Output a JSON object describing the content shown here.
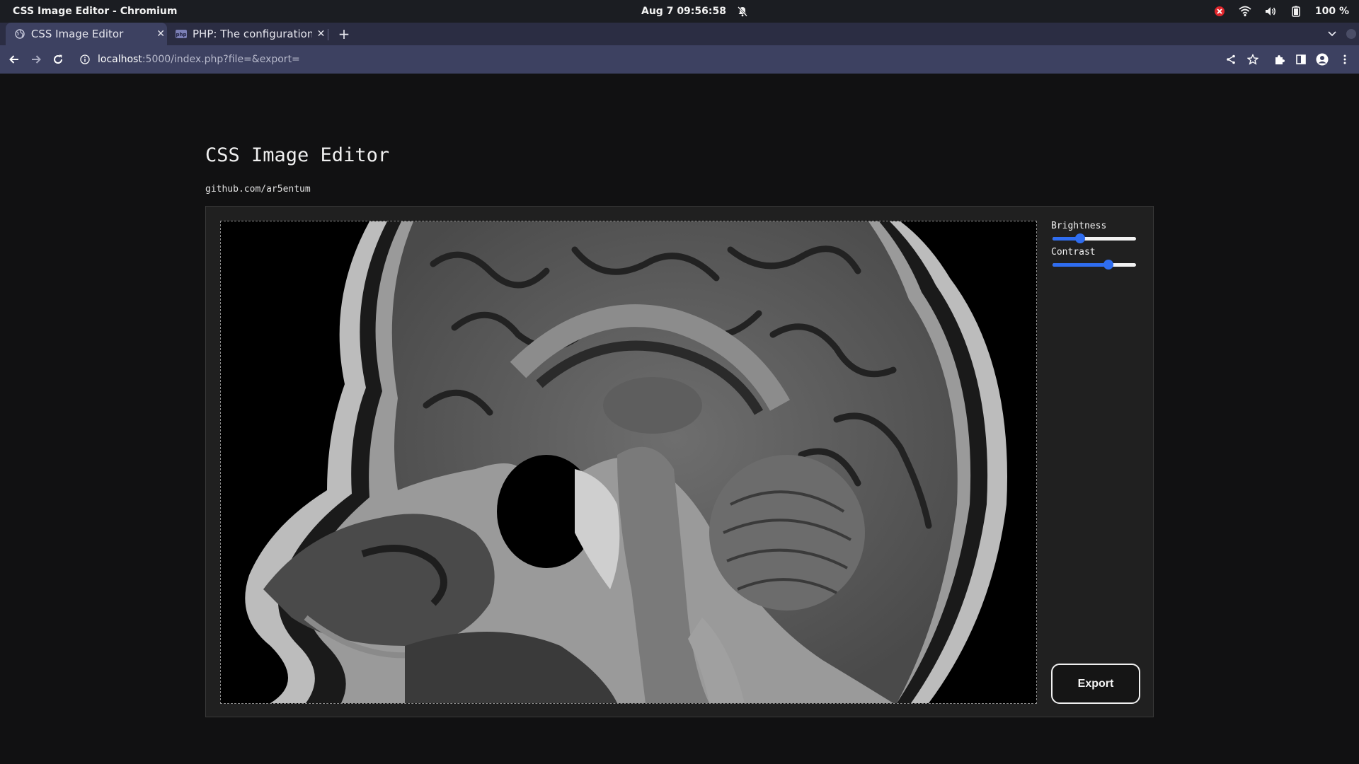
{
  "os": {
    "window_title": "CSS Image Editor - Chromium",
    "clock": "Aug 7  09:56:58",
    "battery": "100 %"
  },
  "browser": {
    "tabs": [
      {
        "label": "CSS Image Editor",
        "active": true,
        "favicon": "globe-icon"
      },
      {
        "label": "PHP: The configuration",
        "active": false,
        "favicon": "php-icon"
      }
    ],
    "url_host": "localhost",
    "url_rest": ":5000/index.php?file=&export=",
    "favicon_php_text": "php"
  },
  "page": {
    "title": "CSS Image Editor",
    "subtitle": "github.com/ar5entum"
  },
  "controls": {
    "brightness": {
      "label": "Brightness",
      "value_fraction": 0.33
    },
    "contrast": {
      "label": "Contrast",
      "value_fraction": 0.67
    }
  },
  "export_label": "Export",
  "colors": {
    "accent": "#2f6df0",
    "tab_strip": "#2b2d43",
    "toolbar": "#3d4161"
  }
}
